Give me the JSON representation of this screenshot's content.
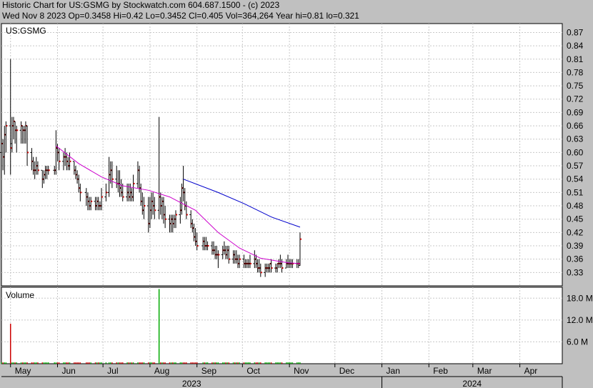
{
  "header": {
    "line1": "Historic Chart for US:GSMG by Stockwatch.com 604.687.1500 - (c) 2023",
    "line2": "Wed Nov  8 2023   Op=0.3458  Hi=0.42  Lo=0.3452  Cl=0.405  Vol=364,264  Year hi=0.81  lo=0.321"
  },
  "chart_data": [
    {
      "type": "ohlc",
      "title": "US:GSMG",
      "ylim": [
        0.3,
        0.89
      ],
      "yticks": [
        0.87,
        0.84,
        0.81,
        0.78,
        0.75,
        0.72,
        0.69,
        0.66,
        0.63,
        0.6,
        0.57,
        0.54,
        0.51,
        0.48,
        0.45,
        0.42,
        0.39,
        0.36,
        0.33
      ],
      "ytick_labels": [
        "0.87",
        "0.84",
        "0.81",
        "0.78",
        "0.75",
        "0.72",
        "0.69",
        "0.66",
        "0.63",
        "0.60",
        "0.57",
        "0.54",
        "0.51",
        "0.48",
        "0.45",
        "0.42",
        "0.39",
        "0.36",
        "0.33"
      ],
      "x_start": "2023-04-25",
      "x_end": "2024-04-29",
      "month_labels": [
        {
          "date": "2023-05-01",
          "label": "May"
        },
        {
          "date": "2023-06-01",
          "label": "Jun"
        },
        {
          "date": "2023-07-01",
          "label": "Jul"
        },
        {
          "date": "2023-08-01",
          "label": "Aug"
        },
        {
          "date": "2023-09-01",
          "label": "Sep"
        },
        {
          "date": "2023-10-01",
          "label": "Oct"
        },
        {
          "date": "2023-11-01",
          "label": "Nov"
        },
        {
          "date": "2023-12-01",
          "label": "Dec"
        },
        {
          "date": "2024-01-01",
          "label": "Jan"
        },
        {
          "date": "2024-02-01",
          "label": "Feb"
        },
        {
          "date": "2024-03-01",
          "label": "Mar"
        },
        {
          "date": "2024-04-01",
          "label": "Apr"
        }
      ],
      "year_labels": [
        {
          "start": "2023-04-25",
          "end": "2024-01-01",
          "label": "2023"
        },
        {
          "start": "2024-01-01",
          "end": "2024-04-29",
          "label": "2024"
        }
      ],
      "ohlc": [
        [
          "2023-04-25",
          0.6,
          0.66,
          0.56,
          0.62
        ],
        [
          "2023-04-26",
          0.62,
          0.63,
          0.56,
          0.59
        ],
        [
          "2023-04-27",
          0.59,
          0.66,
          0.55,
          0.64
        ],
        [
          "2023-04-28",
          0.64,
          0.67,
          0.6,
          0.66
        ],
        [
          "2023-05-01",
          0.66,
          0.81,
          0.55,
          0.61
        ],
        [
          "2023-05-02",
          0.62,
          0.68,
          0.6,
          0.66
        ],
        [
          "2023-05-03",
          0.66,
          0.68,
          0.63,
          0.67
        ],
        [
          "2023-05-04",
          0.67,
          0.67,
          0.62,
          0.65
        ],
        [
          "2023-05-05",
          0.65,
          0.66,
          0.6,
          0.65
        ],
        [
          "2023-05-08",
          0.65,
          0.67,
          0.62,
          0.66
        ],
        [
          "2023-05-09",
          0.66,
          0.66,
          0.62,
          0.65
        ],
        [
          "2023-05-10",
          0.65,
          0.66,
          0.62,
          0.65
        ],
        [
          "2023-05-11",
          0.65,
          0.67,
          0.62,
          0.66
        ],
        [
          "2023-05-12",
          0.66,
          0.66,
          0.57,
          0.6
        ],
        [
          "2023-05-15",
          0.6,
          0.61,
          0.56,
          0.58
        ],
        [
          "2023-05-16",
          0.58,
          0.59,
          0.55,
          0.56
        ],
        [
          "2023-05-17",
          0.56,
          0.58,
          0.54,
          0.56
        ],
        [
          "2023-05-18",
          0.56,
          0.59,
          0.55,
          0.57
        ],
        [
          "2023-05-19",
          0.57,
          0.58,
          0.55,
          0.56
        ],
        [
          "2023-05-22",
          0.56,
          0.56,
          0.52,
          0.54
        ],
        [
          "2023-05-23",
          0.54,
          0.56,
          0.53,
          0.55
        ],
        [
          "2023-05-24",
          0.55,
          0.57,
          0.54,
          0.56
        ],
        [
          "2023-05-25",
          0.56,
          0.57,
          0.54,
          0.56
        ],
        [
          "2023-05-26",
          0.56,
          0.57,
          0.55,
          0.56
        ],
        [
          "2023-05-30",
          0.56,
          0.57,
          0.55,
          0.56
        ],
        [
          "2023-05-31",
          0.56,
          0.65,
          0.55,
          0.61
        ],
        [
          "2023-06-01",
          0.61,
          0.62,
          0.58,
          0.6
        ],
        [
          "2023-06-02",
          0.6,
          0.61,
          0.56,
          0.58
        ],
        [
          "2023-06-05",
          0.58,
          0.6,
          0.56,
          0.59
        ],
        [
          "2023-06-06",
          0.59,
          0.61,
          0.57,
          0.59
        ],
        [
          "2023-06-07",
          0.59,
          0.6,
          0.56,
          0.58
        ],
        [
          "2023-06-08",
          0.58,
          0.59,
          0.56,
          0.57
        ],
        [
          "2023-06-09",
          0.57,
          0.6,
          0.56,
          0.58
        ],
        [
          "2023-06-12",
          0.58,
          0.58,
          0.55,
          0.56
        ],
        [
          "2023-06-13",
          0.56,
          0.57,
          0.54,
          0.55
        ],
        [
          "2023-06-14",
          0.55,
          0.56,
          0.53,
          0.54
        ],
        [
          "2023-06-15",
          0.54,
          0.55,
          0.51,
          0.52
        ],
        [
          "2023-06-16",
          0.52,
          0.53,
          0.49,
          0.51
        ],
        [
          "2023-06-20",
          0.51,
          0.52,
          0.48,
          0.5
        ],
        [
          "2023-06-21",
          0.5,
          0.51,
          0.47,
          0.49
        ],
        [
          "2023-06-22",
          0.49,
          0.5,
          0.47,
          0.48
        ],
        [
          "2023-06-23",
          0.48,
          0.5,
          0.47,
          0.49
        ],
        [
          "2023-06-26",
          0.49,
          0.5,
          0.47,
          0.48
        ],
        [
          "2023-06-27",
          0.48,
          0.5,
          0.47,
          0.49
        ],
        [
          "2023-06-28",
          0.49,
          0.5,
          0.47,
          0.48
        ],
        [
          "2023-06-29",
          0.48,
          0.49,
          0.47,
          0.48
        ],
        [
          "2023-06-30",
          0.48,
          0.52,
          0.47,
          0.5
        ],
        [
          "2023-07-03",
          0.5,
          0.53,
          0.49,
          0.51
        ],
        [
          "2023-07-05",
          0.51,
          0.59,
          0.5,
          0.55
        ],
        [
          "2023-07-06",
          0.55,
          0.58,
          0.53,
          0.56
        ],
        [
          "2023-07-07",
          0.56,
          0.58,
          0.52,
          0.54
        ],
        [
          "2023-07-10",
          0.54,
          0.57,
          0.52,
          0.53
        ],
        [
          "2023-07-11",
          0.53,
          0.56,
          0.51,
          0.53
        ],
        [
          "2023-07-12",
          0.53,
          0.56,
          0.5,
          0.52
        ],
        [
          "2023-07-13",
          0.52,
          0.54,
          0.5,
          0.51
        ],
        [
          "2023-07-14",
          0.51,
          0.53,
          0.49,
          0.5
        ],
        [
          "2023-07-17",
          0.5,
          0.53,
          0.49,
          0.51
        ],
        [
          "2023-07-18",
          0.51,
          0.53,
          0.49,
          0.5
        ],
        [
          "2023-07-19",
          0.5,
          0.53,
          0.49,
          0.51
        ],
        [
          "2023-07-20",
          0.51,
          0.52,
          0.49,
          0.5
        ],
        [
          "2023-07-21",
          0.5,
          0.55,
          0.49,
          0.53
        ],
        [
          "2023-07-24",
          0.53,
          0.58,
          0.52,
          0.56
        ],
        [
          "2023-07-25",
          0.56,
          0.57,
          0.51,
          0.52
        ],
        [
          "2023-07-26",
          0.52,
          0.53,
          0.48,
          0.49
        ],
        [
          "2023-07-27",
          0.49,
          0.51,
          0.46,
          0.47
        ],
        [
          "2023-07-28",
          0.47,
          0.5,
          0.45,
          0.48
        ],
        [
          "2023-07-31",
          0.48,
          0.5,
          0.42,
          0.44
        ],
        [
          "2023-08-01",
          0.44,
          0.5,
          0.43,
          0.47
        ],
        [
          "2023-08-02",
          0.47,
          0.51,
          0.45,
          0.49
        ],
        [
          "2023-08-03",
          0.49,
          0.51,
          0.46,
          0.48
        ],
        [
          "2023-08-04",
          0.48,
          0.5,
          0.45,
          0.47
        ],
        [
          "2023-08-07",
          0.47,
          0.68,
          0.45,
          0.5
        ],
        [
          "2023-08-08",
          0.5,
          0.51,
          0.46,
          0.48
        ],
        [
          "2023-08-09",
          0.48,
          0.5,
          0.45,
          0.49
        ],
        [
          "2023-08-10",
          0.49,
          0.5,
          0.44,
          0.46
        ],
        [
          "2023-08-11",
          0.46,
          0.48,
          0.43,
          0.45
        ],
        [
          "2023-08-14",
          0.45,
          0.46,
          0.42,
          0.44
        ],
        [
          "2023-08-15",
          0.44,
          0.46,
          0.42,
          0.45
        ],
        [
          "2023-08-16",
          0.45,
          0.46,
          0.42,
          0.44
        ],
        [
          "2023-08-17",
          0.44,
          0.46,
          0.43,
          0.45
        ],
        [
          "2023-08-18",
          0.45,
          0.47,
          0.43,
          0.46
        ],
        [
          "2023-08-21",
          0.46,
          0.5,
          0.44,
          0.47
        ],
        [
          "2023-08-22",
          0.47,
          0.53,
          0.46,
          0.52
        ],
        [
          "2023-08-23",
          0.52,
          0.57,
          0.49,
          0.51
        ],
        [
          "2023-08-24",
          0.51,
          0.52,
          0.47,
          0.48
        ],
        [
          "2023-08-25",
          0.48,
          0.49,
          0.45,
          0.46
        ],
        [
          "2023-08-28",
          0.46,
          0.47,
          0.43,
          0.44
        ],
        [
          "2023-08-29",
          0.44,
          0.45,
          0.42,
          0.43
        ],
        [
          "2023-08-30",
          0.43,
          0.44,
          0.4,
          0.41
        ],
        [
          "2023-08-31",
          0.41,
          0.43,
          0.39,
          0.4
        ],
        [
          "2023-09-01",
          0.4,
          0.42,
          0.38,
          0.39
        ],
        [
          "2023-09-05",
          0.39,
          0.41,
          0.38,
          0.4
        ],
        [
          "2023-09-06",
          0.4,
          0.41,
          0.38,
          0.39
        ],
        [
          "2023-09-07",
          0.39,
          0.41,
          0.38,
          0.39
        ],
        [
          "2023-09-08",
          0.39,
          0.4,
          0.38,
          0.39
        ],
        [
          "2023-09-11",
          0.39,
          0.4,
          0.37,
          0.38
        ],
        [
          "2023-09-12",
          0.38,
          0.4,
          0.37,
          0.38
        ],
        [
          "2023-09-13",
          0.38,
          0.39,
          0.36,
          0.37
        ],
        [
          "2023-09-14",
          0.37,
          0.39,
          0.36,
          0.37
        ],
        [
          "2023-09-15",
          0.37,
          0.38,
          0.34,
          0.37
        ],
        [
          "2023-09-18",
          0.37,
          0.39,
          0.36,
          0.38
        ],
        [
          "2023-09-19",
          0.38,
          0.4,
          0.37,
          0.38
        ],
        [
          "2023-09-20",
          0.38,
          0.39,
          0.36,
          0.37
        ],
        [
          "2023-09-21",
          0.37,
          0.39,
          0.36,
          0.38
        ],
        [
          "2023-09-22",
          0.38,
          0.39,
          0.35,
          0.36
        ],
        [
          "2023-09-25",
          0.36,
          0.38,
          0.35,
          0.37
        ],
        [
          "2023-09-26",
          0.37,
          0.38,
          0.35,
          0.36
        ],
        [
          "2023-09-27",
          0.36,
          0.38,
          0.35,
          0.36
        ],
        [
          "2023-09-28",
          0.36,
          0.37,
          0.34,
          0.35
        ],
        [
          "2023-09-29",
          0.35,
          0.37,
          0.34,
          0.36
        ],
        [
          "2023-10-02",
          0.36,
          0.37,
          0.34,
          0.35
        ],
        [
          "2023-10-03",
          0.35,
          0.36,
          0.34,
          0.35
        ],
        [
          "2023-10-04",
          0.35,
          0.36,
          0.34,
          0.35
        ],
        [
          "2023-10-05",
          0.35,
          0.36,
          0.34,
          0.35
        ],
        [
          "2023-10-06",
          0.35,
          0.37,
          0.34,
          0.35
        ],
        [
          "2023-10-09",
          0.35,
          0.38,
          0.34,
          0.36
        ],
        [
          "2023-10-10",
          0.36,
          0.37,
          0.34,
          0.35
        ],
        [
          "2023-10-11",
          0.35,
          0.36,
          0.33,
          0.34
        ],
        [
          "2023-10-12",
          0.34,
          0.36,
          0.33,
          0.34
        ],
        [
          "2023-10-13",
          0.34,
          0.35,
          0.32,
          0.33
        ],
        [
          "2023-10-16",
          0.33,
          0.35,
          0.32,
          0.34
        ],
        [
          "2023-10-17",
          0.34,
          0.35,
          0.33,
          0.34
        ],
        [
          "2023-10-18",
          0.34,
          0.35,
          0.33,
          0.34
        ],
        [
          "2023-10-19",
          0.34,
          0.35,
          0.33,
          0.35
        ],
        [
          "2023-10-20",
          0.35,
          0.36,
          0.33,
          0.34
        ],
        [
          "2023-10-23",
          0.34,
          0.35,
          0.33,
          0.34
        ],
        [
          "2023-10-24",
          0.34,
          0.35,
          0.33,
          0.35
        ],
        [
          "2023-10-25",
          0.35,
          0.36,
          0.34,
          0.35
        ],
        [
          "2023-10-26",
          0.35,
          0.37,
          0.34,
          0.35
        ],
        [
          "2023-10-27",
          0.35,
          0.36,
          0.33,
          0.34
        ],
        [
          "2023-10-30",
          0.34,
          0.36,
          0.34,
          0.35
        ],
        [
          "2023-10-31",
          0.35,
          0.37,
          0.34,
          0.35
        ],
        [
          "2023-11-01",
          0.35,
          0.36,
          0.34,
          0.35
        ],
        [
          "2023-11-02",
          0.35,
          0.36,
          0.34,
          0.35
        ],
        [
          "2023-11-03",
          0.35,
          0.36,
          0.34,
          0.35
        ],
        [
          "2023-11-06",
          0.35,
          0.36,
          0.34,
          0.35
        ],
        [
          "2023-11-07",
          0.35,
          0.36,
          0.34,
          0.35
        ],
        [
          "2023-11-08",
          0.3458,
          0.42,
          0.3452,
          0.405
        ]
      ],
      "ma_short": {
        "color": "#cc00cc",
        "points": [
          [
            "2023-05-31",
            0.615
          ],
          [
            "2023-06-15",
            0.575
          ],
          [
            "2023-06-30",
            0.545
          ],
          [
            "2023-07-14",
            0.525
          ],
          [
            "2023-07-31",
            0.515
          ],
          [
            "2023-08-14",
            0.5
          ],
          [
            "2023-08-31",
            0.47
          ],
          [
            "2023-09-15",
            0.42
          ],
          [
            "2023-09-29",
            0.385
          ],
          [
            "2023-10-13",
            0.362
          ],
          [
            "2023-10-31",
            0.352
          ],
          [
            "2023-11-08",
            0.35
          ]
        ]
      },
      "ma_long": {
        "color": "#0000cc",
        "points": [
          [
            "2023-08-23",
            0.54
          ],
          [
            "2023-09-15",
            0.51
          ],
          [
            "2023-10-02",
            0.485
          ],
          [
            "2023-10-20",
            0.455
          ],
          [
            "2023-11-08",
            0.432
          ]
        ]
      }
    },
    {
      "type": "bar",
      "title": "Volume",
      "ylim": [
        0,
        21000000
      ],
      "yticks": [
        6000000,
        12000000,
        18000000
      ],
      "ytick_labels": [
        "6.0 M",
        "12.0 M",
        "18.0 M"
      ],
      "spikes": [
        {
          "date": "2023-05-01",
          "value": 11000000,
          "color": "#cc0000"
        },
        {
          "date": "2023-08-07",
          "value": 20500000,
          "color": "#00aa00"
        }
      ],
      "baseline_volume": 350000,
      "up_color": "#00aa00",
      "down_color": "#cc0000"
    }
  ]
}
